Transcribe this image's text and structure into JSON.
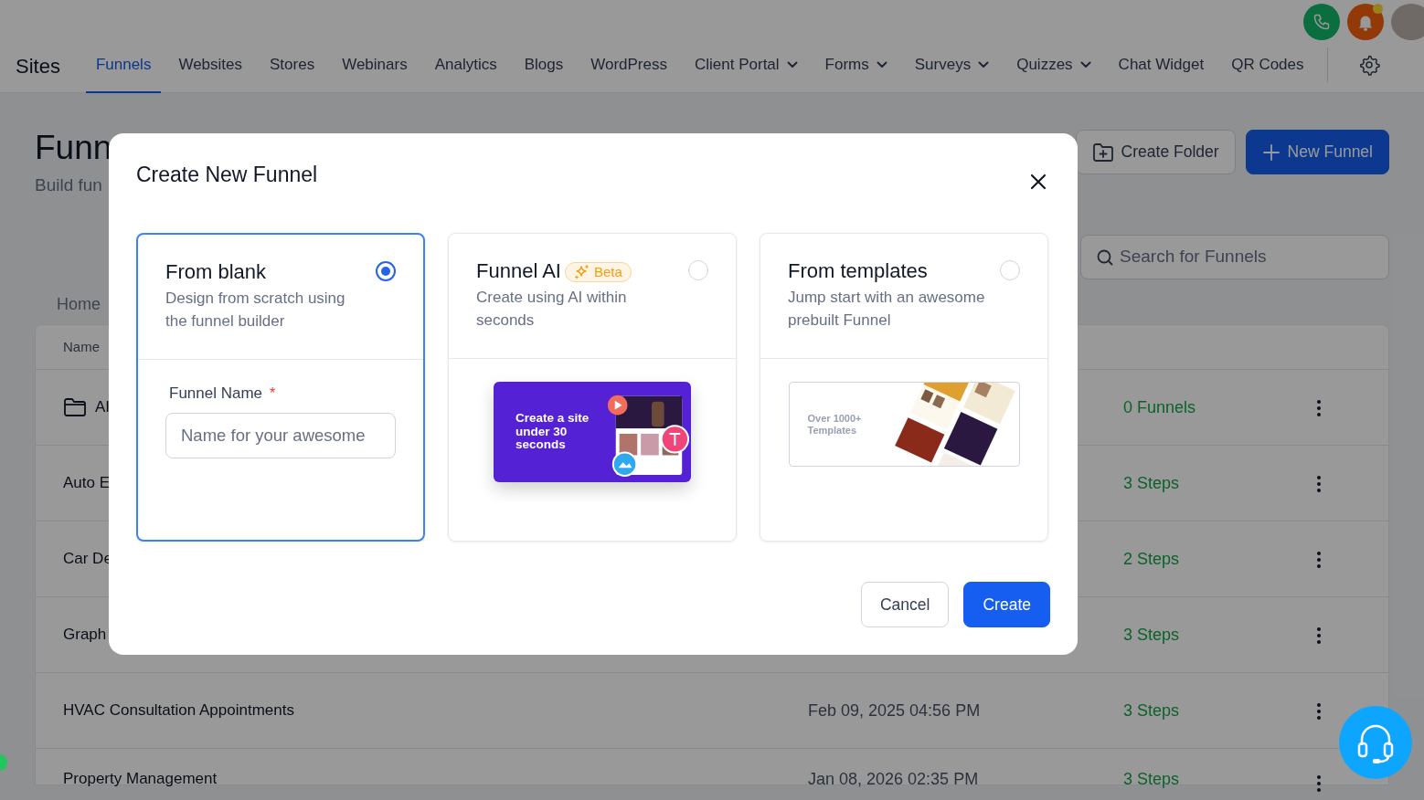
{
  "header": {
    "title": "Sites",
    "tabs": [
      {
        "label": "Funnels",
        "selected": true,
        "dropdown": false
      },
      {
        "label": "Websites",
        "selected": false,
        "dropdown": false
      },
      {
        "label": "Stores",
        "selected": false,
        "dropdown": false
      },
      {
        "label": "Webinars",
        "selected": false,
        "dropdown": false
      },
      {
        "label": "Analytics",
        "selected": false,
        "dropdown": false
      },
      {
        "label": "Blogs",
        "selected": false,
        "dropdown": false
      },
      {
        "label": "WordPress",
        "selected": false,
        "dropdown": false
      },
      {
        "label": "Client Portal",
        "selected": false,
        "dropdown": true
      },
      {
        "label": "Forms",
        "selected": false,
        "dropdown": true
      },
      {
        "label": "Surveys",
        "selected": false,
        "dropdown": true
      },
      {
        "label": "Quizzes",
        "selected": false,
        "dropdown": true
      },
      {
        "label": "Chat Widget",
        "selected": false,
        "dropdown": false
      },
      {
        "label": "QR Codes",
        "selected": false,
        "dropdown": false
      }
    ]
  },
  "page": {
    "title": "Funn",
    "subtitle": "Build fun",
    "actions": [
      {
        "label": "Create Folder",
        "kind": "outline"
      },
      {
        "label": "New Funnel",
        "kind": "primary"
      }
    ],
    "search": {
      "placeholder": "Search for Funnels"
    },
    "breadcrumb": "Home",
    "table": {
      "columns": [
        "Name"
      ],
      "rows": [
        {
          "kind": "folder",
          "name": "AI",
          "count": "0 Funnels"
        },
        {
          "kind": "funnel",
          "name": "Auto E",
          "count": "3 Steps"
        },
        {
          "kind": "funnel",
          "name": "Car De",
          "count": "2 Steps"
        },
        {
          "kind": "funnel",
          "name": "Graph",
          "count": "3 Steps"
        },
        {
          "kind": "funnel",
          "name": "HVAC Consultation Appointments",
          "date": "Feb 09, 2025 04:56 PM",
          "count": "3 Steps"
        },
        {
          "kind": "funnel",
          "name": "Property Management",
          "date": "Jan 08, 2026 02:35 PM",
          "count": "3 Steps"
        }
      ]
    }
  },
  "modal": {
    "title": "Create New Funnel",
    "options": [
      {
        "kind": "blank",
        "title": "From blank",
        "description": "Design from scratch using the funnel builder",
        "selected": true,
        "field": {
          "label": "Funnel Name",
          "required_mark": "*",
          "placeholder": "Name for your awesome"
        }
      },
      {
        "kind": "ai",
        "title": "Funnel AI",
        "badge": "Beta",
        "description": "Create using AI within seconds",
        "selected": false,
        "preview": {
          "headline": "Create a site under 30 seconds"
        }
      },
      {
        "kind": "templates",
        "title": "From templates",
        "description": "Jump start with an awesome prebuilt Funnel",
        "selected": false,
        "preview": {
          "headline": "Over 1000+ Templates"
        }
      }
    ],
    "buttons": [
      {
        "label": "Cancel",
        "kind": "secondary"
      },
      {
        "label": "Create",
        "kind": "primary"
      }
    ]
  }
}
